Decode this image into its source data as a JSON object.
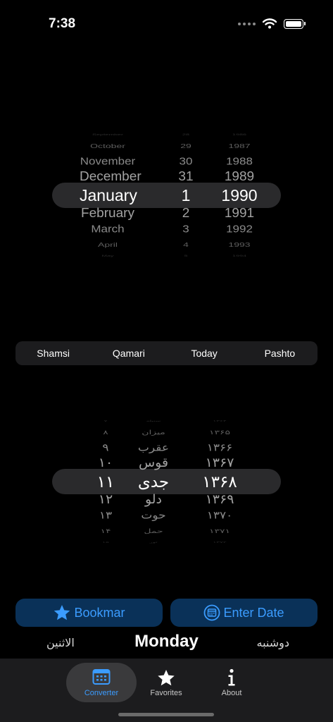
{
  "status_bar": {
    "time": "7:38"
  },
  "gregorian_picker": {
    "rows": [
      {
        "month": "September",
        "day": "28",
        "year": "1986"
      },
      {
        "month": "October",
        "day": "29",
        "year": "1987"
      },
      {
        "month": "November",
        "day": "30",
        "year": "1988"
      },
      {
        "month": "December",
        "day": "31",
        "year": "1989"
      },
      {
        "month": "January",
        "day": "1",
        "year": "1990"
      },
      {
        "month": "February",
        "day": "2",
        "year": "1991"
      },
      {
        "month": "March",
        "day": "3",
        "year": "1992"
      },
      {
        "month": "April",
        "day": "4",
        "year": "1993"
      },
      {
        "month": "May",
        "day": "5",
        "year": "1994"
      }
    ]
  },
  "calendar_tabs": [
    "Shamsi",
    "Qamari",
    "Today",
    "Pashto"
  ],
  "shamsi_picker": {
    "rows": [
      {
        "day": "۷",
        "month": "سنبله",
        "year": "۱۳۶۴"
      },
      {
        "day": "۸",
        "month": "میزان",
        "year": "۱۳۶۵"
      },
      {
        "day": "۹",
        "month": "عقرب",
        "year": "۱۳۶۶"
      },
      {
        "day": "۱۰",
        "month": "قوس",
        "year": "۱۳۶۷"
      },
      {
        "day": "۱۱",
        "month": "جدی",
        "year": "۱۳۶۸"
      },
      {
        "day": "۱۲",
        "month": "دلو",
        "year": "۱۳۶۹"
      },
      {
        "day": "۱۳",
        "month": "حوت",
        "year": "۱۳۷۰"
      },
      {
        "day": "۱۴",
        "month": "حمل",
        "year": "۱۳۷۱"
      },
      {
        "day": "۱۵",
        "month": "ثور",
        "year": "۱۳۷۲"
      }
    ]
  },
  "actions": {
    "bookmark_label": "Bookmar",
    "enter_date_label": "Enter Date"
  },
  "weekday": {
    "arabic": "الاثنين",
    "english": "Monday",
    "persian": "دوشنبه"
  },
  "tabbar": {
    "converter": "Converter",
    "favorites": "Favorites",
    "about": "About"
  },
  "colors": {
    "accent": "#3b9cff",
    "button_bg": "#0a3158",
    "tabbar_bg": "#1c1c1e",
    "highlight_band": "#2a2a2c"
  },
  "icons": {
    "bookmark": "star-icon",
    "enter_date": "calendar-icon",
    "converter": "calendar-icon",
    "favorites": "star-icon",
    "about": "info-icon"
  }
}
